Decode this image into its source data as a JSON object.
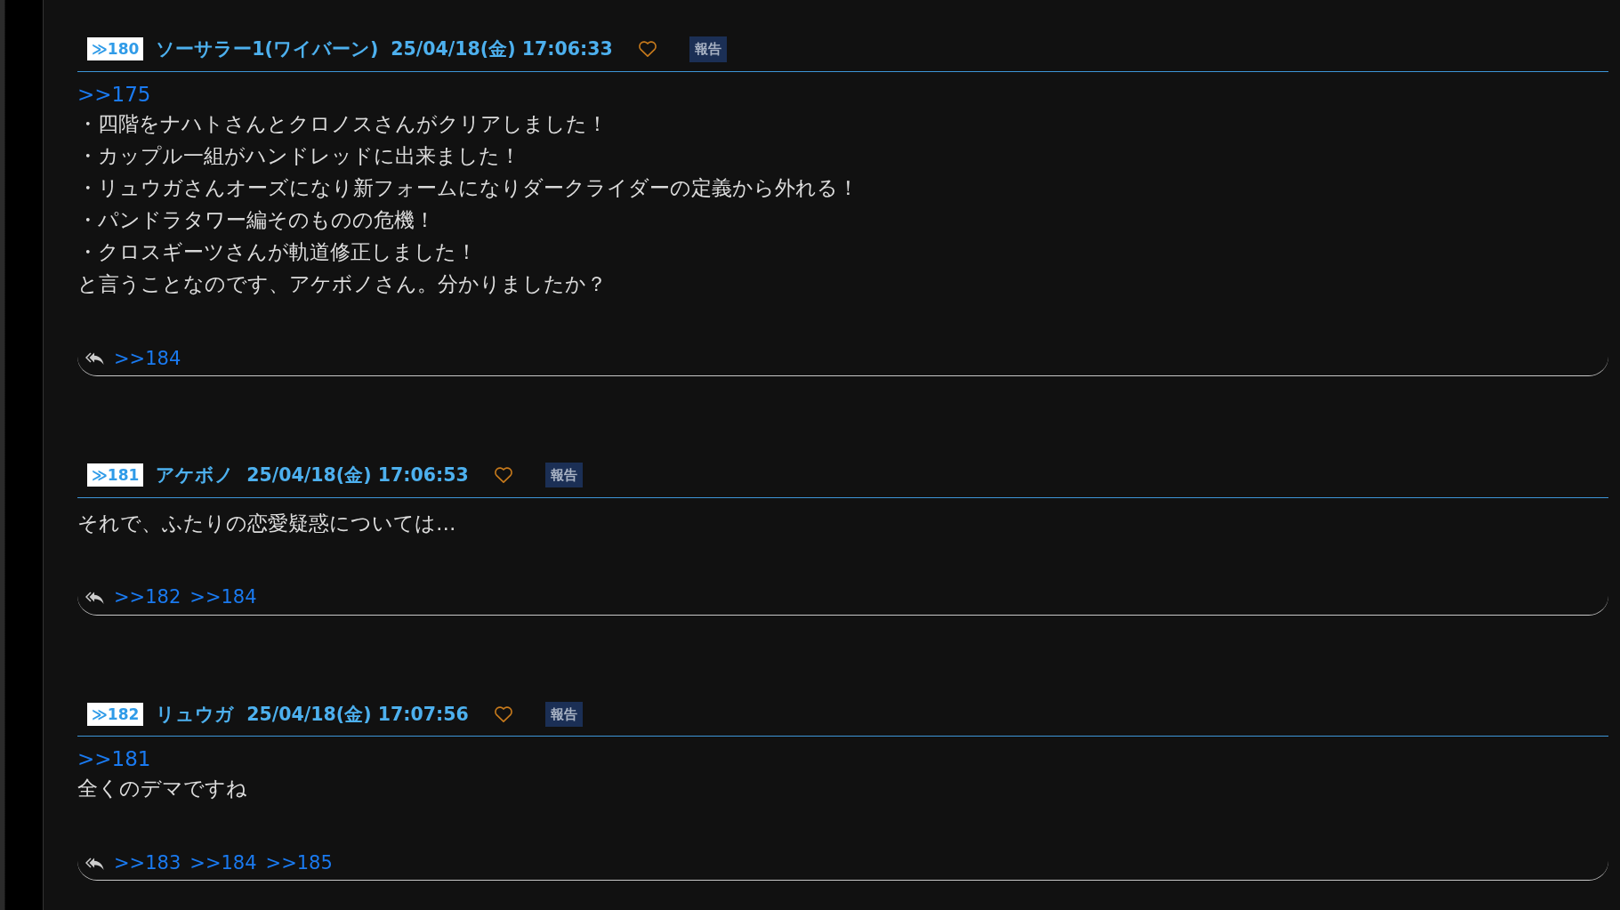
{
  "posts": [
    {
      "number": "≫180",
      "name": "ソーサラー1(ワイバーン)",
      "date": "25/04/18(金) 17:06:33",
      "report": "報告",
      "anchor": ">>175",
      "lines": [
        "・四階をナハトさんとクロノスさんがクリアしました！",
        "・カップル一組がハンドレッドに出来ました！",
        "・リュウガさんオーズになり新フォームになりダークライダーの定義から外れる！",
        "・パンドラタワー編そのものの危機！",
        "・クロスギーツさんが軌道修正しました！",
        "と言うことなのです、アケボノさん。分かりましたか？"
      ],
      "replies": [
        ">>184"
      ]
    },
    {
      "number": "≫181",
      "name": "アケボノ",
      "date": "25/04/18(金) 17:06:53",
      "report": "報告",
      "lines": [
        "それで、ふたりの恋愛疑惑については…"
      ],
      "replies": [
        ">>182",
        ">>184"
      ]
    },
    {
      "number": "≫182",
      "name": "リュウガ",
      "date": "25/04/18(金) 17:07:56",
      "report": "報告",
      "anchor": ">>181",
      "lines": [
        "全くのデマですね"
      ],
      "replies": [
        ">>183",
        ">>184",
        ">>185"
      ]
    }
  ]
}
